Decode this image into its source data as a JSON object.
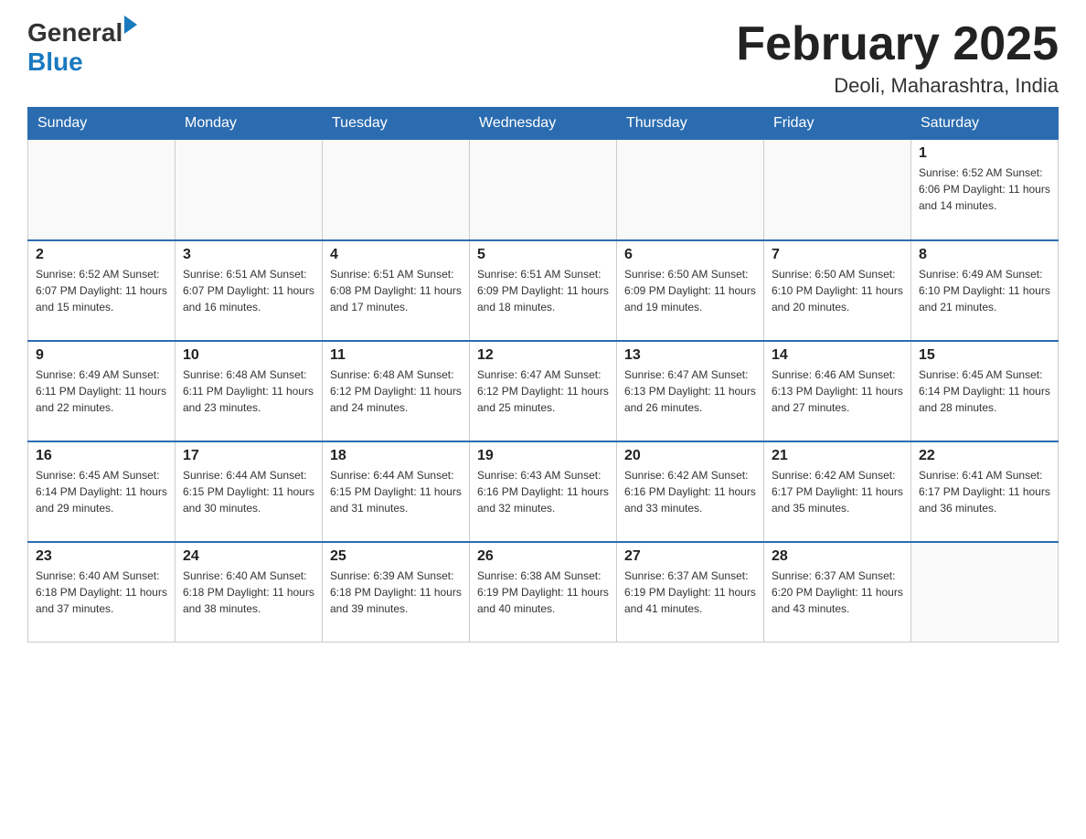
{
  "header": {
    "logo_general": "General",
    "logo_blue": "Blue",
    "month_year": "February 2025",
    "location": "Deoli, Maharashtra, India"
  },
  "days_of_week": [
    "Sunday",
    "Monday",
    "Tuesday",
    "Wednesday",
    "Thursday",
    "Friday",
    "Saturday"
  ],
  "weeks": [
    [
      {
        "day": "",
        "info": ""
      },
      {
        "day": "",
        "info": ""
      },
      {
        "day": "",
        "info": ""
      },
      {
        "day": "",
        "info": ""
      },
      {
        "day": "",
        "info": ""
      },
      {
        "day": "",
        "info": ""
      },
      {
        "day": "1",
        "info": "Sunrise: 6:52 AM\nSunset: 6:06 PM\nDaylight: 11 hours and 14 minutes."
      }
    ],
    [
      {
        "day": "2",
        "info": "Sunrise: 6:52 AM\nSunset: 6:07 PM\nDaylight: 11 hours and 15 minutes."
      },
      {
        "day": "3",
        "info": "Sunrise: 6:51 AM\nSunset: 6:07 PM\nDaylight: 11 hours and 16 minutes."
      },
      {
        "day": "4",
        "info": "Sunrise: 6:51 AM\nSunset: 6:08 PM\nDaylight: 11 hours and 17 minutes."
      },
      {
        "day": "5",
        "info": "Sunrise: 6:51 AM\nSunset: 6:09 PM\nDaylight: 11 hours and 18 minutes."
      },
      {
        "day": "6",
        "info": "Sunrise: 6:50 AM\nSunset: 6:09 PM\nDaylight: 11 hours and 19 minutes."
      },
      {
        "day": "7",
        "info": "Sunrise: 6:50 AM\nSunset: 6:10 PM\nDaylight: 11 hours and 20 minutes."
      },
      {
        "day": "8",
        "info": "Sunrise: 6:49 AM\nSunset: 6:10 PM\nDaylight: 11 hours and 21 minutes."
      }
    ],
    [
      {
        "day": "9",
        "info": "Sunrise: 6:49 AM\nSunset: 6:11 PM\nDaylight: 11 hours and 22 minutes."
      },
      {
        "day": "10",
        "info": "Sunrise: 6:48 AM\nSunset: 6:11 PM\nDaylight: 11 hours and 23 minutes."
      },
      {
        "day": "11",
        "info": "Sunrise: 6:48 AM\nSunset: 6:12 PM\nDaylight: 11 hours and 24 minutes."
      },
      {
        "day": "12",
        "info": "Sunrise: 6:47 AM\nSunset: 6:12 PM\nDaylight: 11 hours and 25 minutes."
      },
      {
        "day": "13",
        "info": "Sunrise: 6:47 AM\nSunset: 6:13 PM\nDaylight: 11 hours and 26 minutes."
      },
      {
        "day": "14",
        "info": "Sunrise: 6:46 AM\nSunset: 6:13 PM\nDaylight: 11 hours and 27 minutes."
      },
      {
        "day": "15",
        "info": "Sunrise: 6:45 AM\nSunset: 6:14 PM\nDaylight: 11 hours and 28 minutes."
      }
    ],
    [
      {
        "day": "16",
        "info": "Sunrise: 6:45 AM\nSunset: 6:14 PM\nDaylight: 11 hours and 29 minutes."
      },
      {
        "day": "17",
        "info": "Sunrise: 6:44 AM\nSunset: 6:15 PM\nDaylight: 11 hours and 30 minutes."
      },
      {
        "day": "18",
        "info": "Sunrise: 6:44 AM\nSunset: 6:15 PM\nDaylight: 11 hours and 31 minutes."
      },
      {
        "day": "19",
        "info": "Sunrise: 6:43 AM\nSunset: 6:16 PM\nDaylight: 11 hours and 32 minutes."
      },
      {
        "day": "20",
        "info": "Sunrise: 6:42 AM\nSunset: 6:16 PM\nDaylight: 11 hours and 33 minutes."
      },
      {
        "day": "21",
        "info": "Sunrise: 6:42 AM\nSunset: 6:17 PM\nDaylight: 11 hours and 35 minutes."
      },
      {
        "day": "22",
        "info": "Sunrise: 6:41 AM\nSunset: 6:17 PM\nDaylight: 11 hours and 36 minutes."
      }
    ],
    [
      {
        "day": "23",
        "info": "Sunrise: 6:40 AM\nSunset: 6:18 PM\nDaylight: 11 hours and 37 minutes."
      },
      {
        "day": "24",
        "info": "Sunrise: 6:40 AM\nSunset: 6:18 PM\nDaylight: 11 hours and 38 minutes."
      },
      {
        "day": "25",
        "info": "Sunrise: 6:39 AM\nSunset: 6:18 PM\nDaylight: 11 hours and 39 minutes."
      },
      {
        "day": "26",
        "info": "Sunrise: 6:38 AM\nSunset: 6:19 PM\nDaylight: 11 hours and 40 minutes."
      },
      {
        "day": "27",
        "info": "Sunrise: 6:37 AM\nSunset: 6:19 PM\nDaylight: 11 hours and 41 minutes."
      },
      {
        "day": "28",
        "info": "Sunrise: 6:37 AM\nSunset: 6:20 PM\nDaylight: 11 hours and 43 minutes."
      },
      {
        "day": "",
        "info": ""
      }
    ]
  ]
}
